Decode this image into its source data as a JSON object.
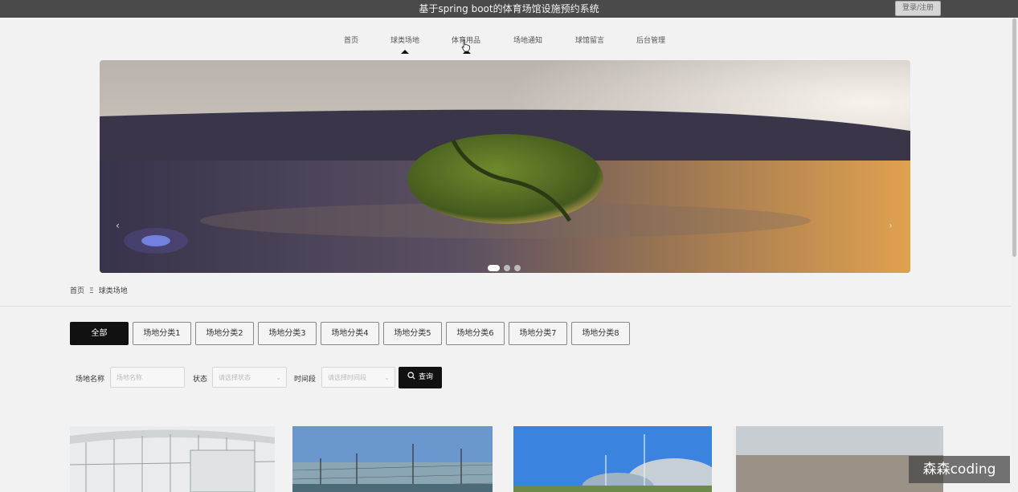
{
  "header": {
    "title": "基于spring boot的体育场馆设施预约系统",
    "login_label": "登录/注册"
  },
  "nav": [
    {
      "label": "首页"
    },
    {
      "label": "球类场地"
    },
    {
      "label": "体育用品"
    },
    {
      "label": "场地通知"
    },
    {
      "label": "球馆留言"
    },
    {
      "label": "后台管理"
    }
  ],
  "banner": {
    "prev": "‹",
    "next": "›",
    "slide_count": 3,
    "active_slide": 1
  },
  "breadcrumb": {
    "home": "首页",
    "separator": "Ξ",
    "current": "球类场地"
  },
  "categories": [
    "全部",
    "场地分类1",
    "场地分类2",
    "场地分类3",
    "场地分类4",
    "场地分类5",
    "场地分类6",
    "场地分类7",
    "场地分类8"
  ],
  "filters": {
    "name_label": "场地名称",
    "name_placeholder": "场地名称",
    "status_label": "状态",
    "status_placeholder": "请选择状态",
    "time_label": "时间段",
    "time_placeholder": "请选择时间段",
    "search_label": "查询"
  },
  "watermark": "森森coding",
  "colors": {
    "topbar": "#4a4a4a",
    "active": "#111111",
    "page_bg": "#f2f2f2"
  }
}
